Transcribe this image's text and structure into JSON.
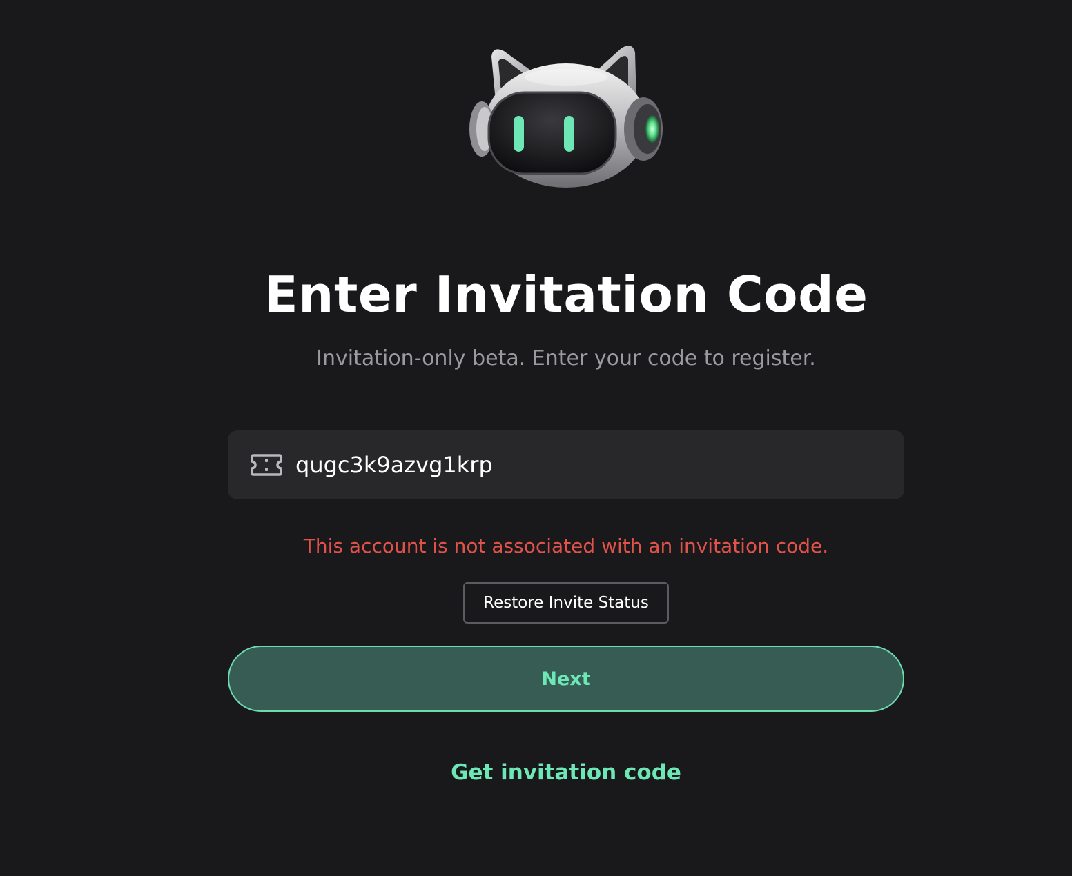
{
  "header": {
    "logo_icon": "robot-cat-mascot-icon",
    "title": "Enter Invitation Code",
    "subtitle": "Invitation-only beta. Enter your code to register."
  },
  "form": {
    "input_icon": "ticket-icon",
    "invitation_code_value": "qugc3k9azvg1krp",
    "error_message": "This account is not associated with an invitation code.",
    "restore_button_label": "Restore Invite Status",
    "next_button_label": "Next",
    "get_code_link_label": "Get invitation code"
  },
  "colors": {
    "background": "#19191b",
    "accent": "#6ee7b7",
    "next_button_bg": "#365c54",
    "error": "#e0524a",
    "input_bg": "#28282b"
  }
}
